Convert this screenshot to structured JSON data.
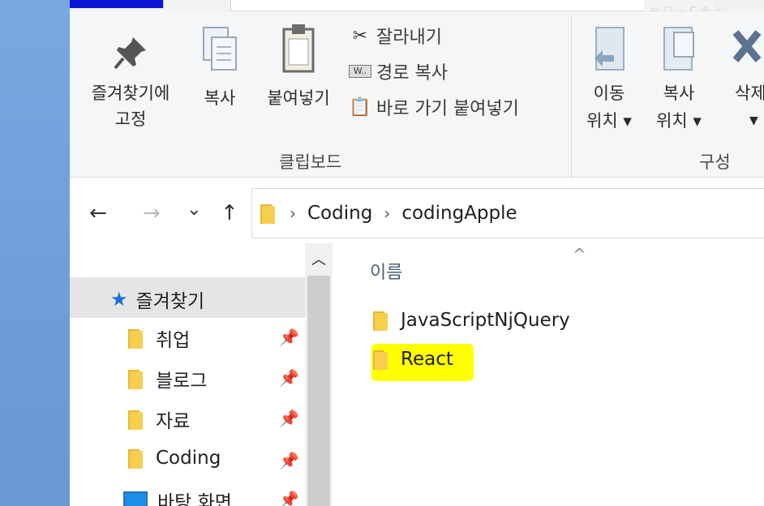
{
  "ribbon": {
    "pin_label_1": "즐겨찾기에",
    "pin_label_2": "고정",
    "copy_label": "복사",
    "paste_label": "붙여넣기",
    "cut_label": "잘라내기",
    "copy_path_label": "경로 복사",
    "paste_shortcut_label": "바로 가기 붙여넣기",
    "clipboard_group": "클립보드",
    "move_label_1": "이동",
    "move_label_2": "위치 ▾",
    "copyto_label_1": "복사",
    "copyto_label_2": "위치 ▾",
    "delete_label_1": "삭제",
    "organize_group": "구성"
  },
  "nav": {
    "back_icon": "←",
    "forward_icon": "→",
    "recent_icon": "⌄",
    "up_icon": "↑",
    "breadcrumbs": [
      "Coding",
      "codingApple"
    ]
  },
  "sidebar": {
    "quick_access_label": "즐겨찾기",
    "items": [
      {
        "label": "취업",
        "icon": "folder-icon"
      },
      {
        "label": "블로그",
        "icon": "folder-icon"
      },
      {
        "label": "자료",
        "icon": "folder-icon"
      },
      {
        "label": "Coding",
        "icon": "folder-icon"
      },
      {
        "label": "바탕 화면",
        "icon": "desktop-icon"
      }
    ]
  },
  "content": {
    "column_name": "이름",
    "files": [
      {
        "name": "JavaScriptNjQuery",
        "highlighted": false
      },
      {
        "name": "React",
        "highlighted": true
      }
    ]
  },
  "colors": {
    "highlight": "#ffff00",
    "folder": "#f6cf4f",
    "title_blue": "#0a17d6"
  }
}
